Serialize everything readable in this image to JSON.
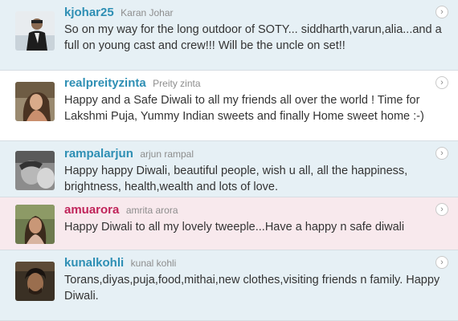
{
  "tweets": [
    {
      "screen_name": "kjohar25",
      "real_name": "Karan Johar",
      "text": "So on my way for the long outdoor of SOTY... siddharth,varun,alia...and a full on young cast and crew!!! Will be the uncle on set!!",
      "menu_icon": "chevron-right-icon"
    },
    {
      "screen_name": "realpreityzinta",
      "real_name": "Preity zinta",
      "text": "Happy and a Safe Diwali to all my friends all over the world ! Time for Lakshmi Puja, Yummy Indian sweets and finally Home sweet home :-)",
      "menu_icon": "chevron-right-icon"
    },
    {
      "screen_name": "rampalarjun",
      "real_name": "arjun rampal",
      "text": "Happy happy Diwali, beautiful people, wish u all, all the happiness, brightness, health,wealth and lots of love.",
      "menu_icon": "chevron-right-icon"
    },
    {
      "screen_name": "amuarora",
      "real_name": "amrita arora",
      "text": "Happy Diwali to all my lovely tweeple...Have a happy n safe diwali",
      "menu_icon": "chevron-right-icon"
    },
    {
      "screen_name": "kunalkohli",
      "real_name": "kunal kohli",
      "text": "Torans,diyas,puja,food,mithai,new clothes,visiting friends n family. Happy Diwali.",
      "menu_icon": "chevron-right-icon"
    }
  ],
  "colors": {
    "screen_name": "#2e8fb4",
    "screen_name_highlight": "#c0245a",
    "row_tint": "#e6f0f5",
    "row_highlight": "#f8e9ed",
    "text": "#333333",
    "real_name": "#8d8d8d"
  }
}
